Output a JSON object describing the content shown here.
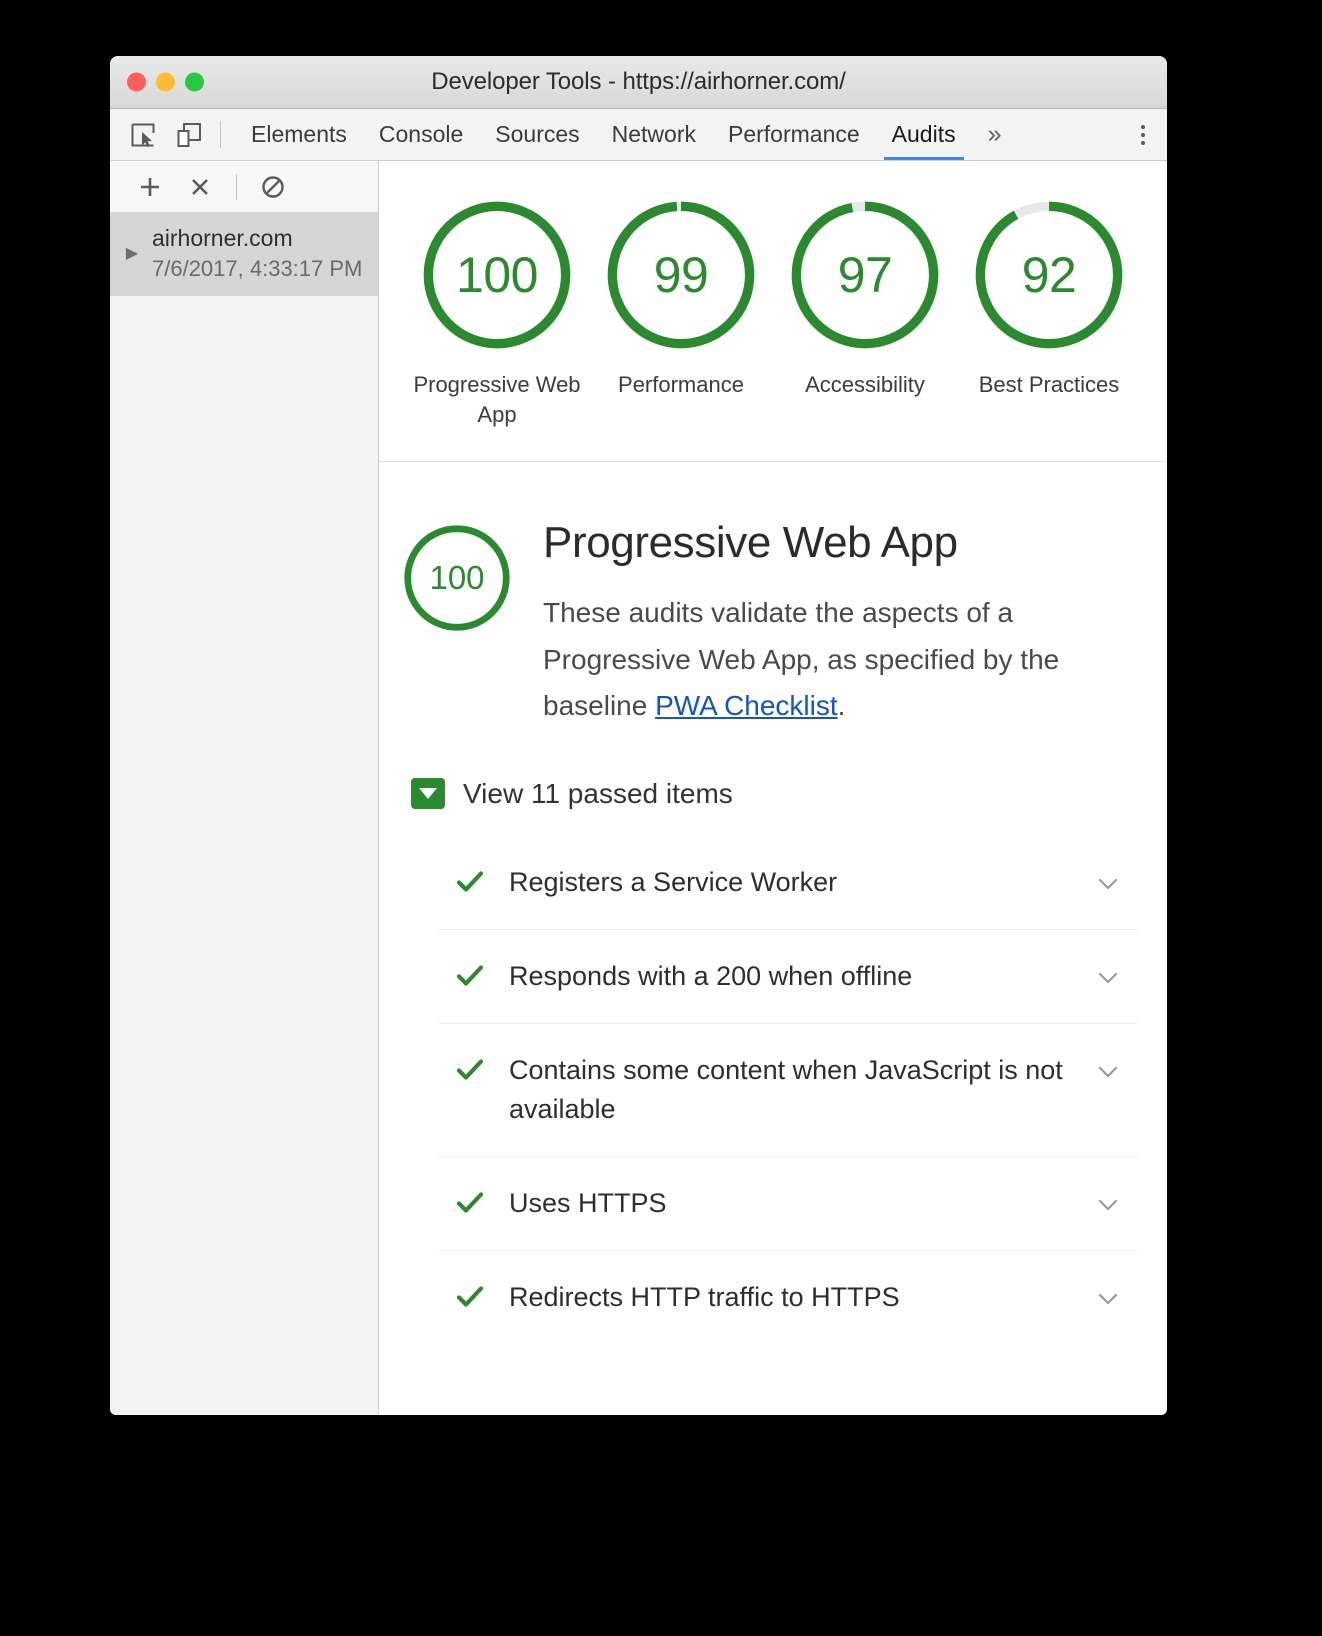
{
  "window": {
    "title": "Developer Tools - https://airhorner.com/",
    "traffic_lights": [
      "close-red",
      "minimize-yellow",
      "maximize-green"
    ]
  },
  "tabbar": {
    "icons": [
      {
        "name": "inspect-element-icon"
      },
      {
        "name": "device-toolbar-icon"
      }
    ],
    "tabs": [
      {
        "label": "Elements",
        "active": false
      },
      {
        "label": "Console",
        "active": false
      },
      {
        "label": "Sources",
        "active": false
      },
      {
        "label": "Network",
        "active": false
      },
      {
        "label": "Performance",
        "active": false
      },
      {
        "label": "Audits",
        "active": true
      }
    ],
    "overflow_label": "»",
    "active_tab_underline_color": "#4285f4",
    "more_menu": "kebab-menu-icon"
  },
  "sidebar": {
    "toolbar": [
      {
        "name": "add-audit-button",
        "glyph": "+"
      },
      {
        "name": "delete-audit-button",
        "glyph": "×"
      },
      {
        "name": "clear-all-button",
        "glyph": "⊘"
      }
    ],
    "runs": [
      {
        "host": "airhorner.com",
        "timestamp": "7/6/2017, 4:33:17 PM",
        "selected": true,
        "caret": "▶"
      }
    ]
  },
  "scores": [
    {
      "value": "100",
      "percent": 100,
      "label": "Progressive Web App"
    },
    {
      "value": "99",
      "percent": 99,
      "label": "Performance"
    },
    {
      "value": "97",
      "percent": 97,
      "label": "Accessibility"
    },
    {
      "value": "92",
      "percent": 92,
      "label": "Best Practices"
    }
  ],
  "category": {
    "score": "100",
    "score_percent": 100,
    "title": "Progressive Web App",
    "description_before": "These audits validate the aspects of a Progressive Web App, as specified by the baseline ",
    "link_text": "PWA Checklist",
    "description_after": "."
  },
  "passed_section": {
    "toggle_label": "View 11 passed items",
    "expanded": true,
    "items": [
      {
        "text": "Registers a Service Worker",
        "status": "pass"
      },
      {
        "text": "Responds with a 200 when offline",
        "status": "pass"
      },
      {
        "text": "Contains some content when JavaScript is not available",
        "status": "pass"
      },
      {
        "text": "Uses HTTPS",
        "status": "pass"
      },
      {
        "text": "Redirects HTTP traffic to HTTPS",
        "status": "pass"
      }
    ]
  },
  "colors": {
    "pass_green": "#2a8b2e",
    "link_blue": "#1155cc",
    "tab_accent": "#4285f4",
    "gauge_track": "#e8e8e8"
  }
}
